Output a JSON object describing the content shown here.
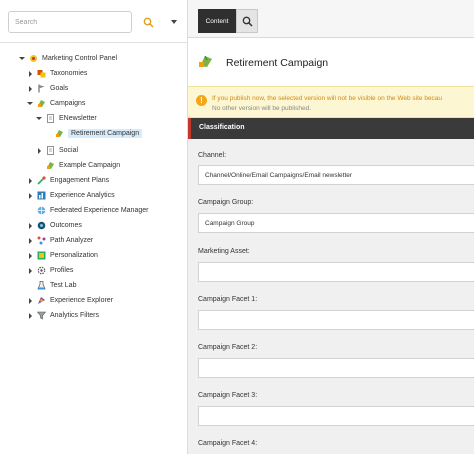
{
  "search": {
    "placeholder": "Search"
  },
  "tree": {
    "items": [
      {
        "label": "Marketing Control Panel",
        "icon": "marketing-panel-icon",
        "expander": "down"
      },
      {
        "label": "Taxonomies",
        "icon": "taxonomy-icon",
        "expander": "right"
      },
      {
        "label": "Goals",
        "icon": "flag-icon",
        "expander": "right"
      },
      {
        "label": "Campaigns",
        "icon": "campaign-icon",
        "expander": "down"
      },
      {
        "label": "ENewsletter",
        "icon": "document-icon",
        "expander": "down"
      },
      {
        "label": "Retirement Campaign",
        "icon": "campaign-icon",
        "expander": "none"
      },
      {
        "label": "Social",
        "icon": "document-icon",
        "expander": "right"
      },
      {
        "label": "Example Campaign",
        "icon": "campaign-icon",
        "expander": "none"
      },
      {
        "label": "Engagement Plans",
        "icon": "engagement-icon",
        "expander": "right"
      },
      {
        "label": "Experience Analytics",
        "icon": "analytics-icon",
        "expander": "right"
      },
      {
        "label": "Federated Experience Manager",
        "icon": "federated-icon",
        "expander": "none"
      },
      {
        "label": "Outcomes",
        "icon": "outcome-icon",
        "expander": "right"
      },
      {
        "label": "Path Analyzer",
        "icon": "path-icon",
        "expander": "right"
      },
      {
        "label": "Personalization",
        "icon": "personalization-icon",
        "expander": "right"
      },
      {
        "label": "Profiles",
        "icon": "profiles-icon",
        "expander": "right"
      },
      {
        "label": "Test Lab",
        "icon": "flask-icon",
        "expander": "none"
      },
      {
        "label": "Experience Explorer",
        "icon": "explorer-icon",
        "expander": "right"
      },
      {
        "label": "Analytics Filters",
        "icon": "filter-icon",
        "expander": "right"
      }
    ]
  },
  "tabs": {
    "content": "Content"
  },
  "item": {
    "title": "Retirement Campaign"
  },
  "warning": {
    "line1": "If you publish now, the selected version will not be visible on the Web site becau",
    "line2": "No other version will be published."
  },
  "section": {
    "title": "Classification"
  },
  "fields": {
    "channel": {
      "label": "Channel:",
      "value": "Channel/Online/Email Campaigns/Email newsletter"
    },
    "campaign_group": {
      "label": "Campaign Group:",
      "value": "Campaign Group"
    },
    "marketing_asset": {
      "label": "Marketing Asset:",
      "value": ""
    },
    "facet1": {
      "label": "Campaign Facet 1:",
      "value": ""
    },
    "facet2": {
      "label": "Campaign Facet 2:",
      "value": ""
    },
    "facet3": {
      "label": "Campaign Facet 3:",
      "value": ""
    },
    "facet4": {
      "label": "Campaign Facet 4:"
    }
  },
  "colors": {
    "section_accent": "#c0392b",
    "warning_text": "#d38a10",
    "tab_active": "#2f2f2f",
    "selection": "#d6ebfb"
  }
}
